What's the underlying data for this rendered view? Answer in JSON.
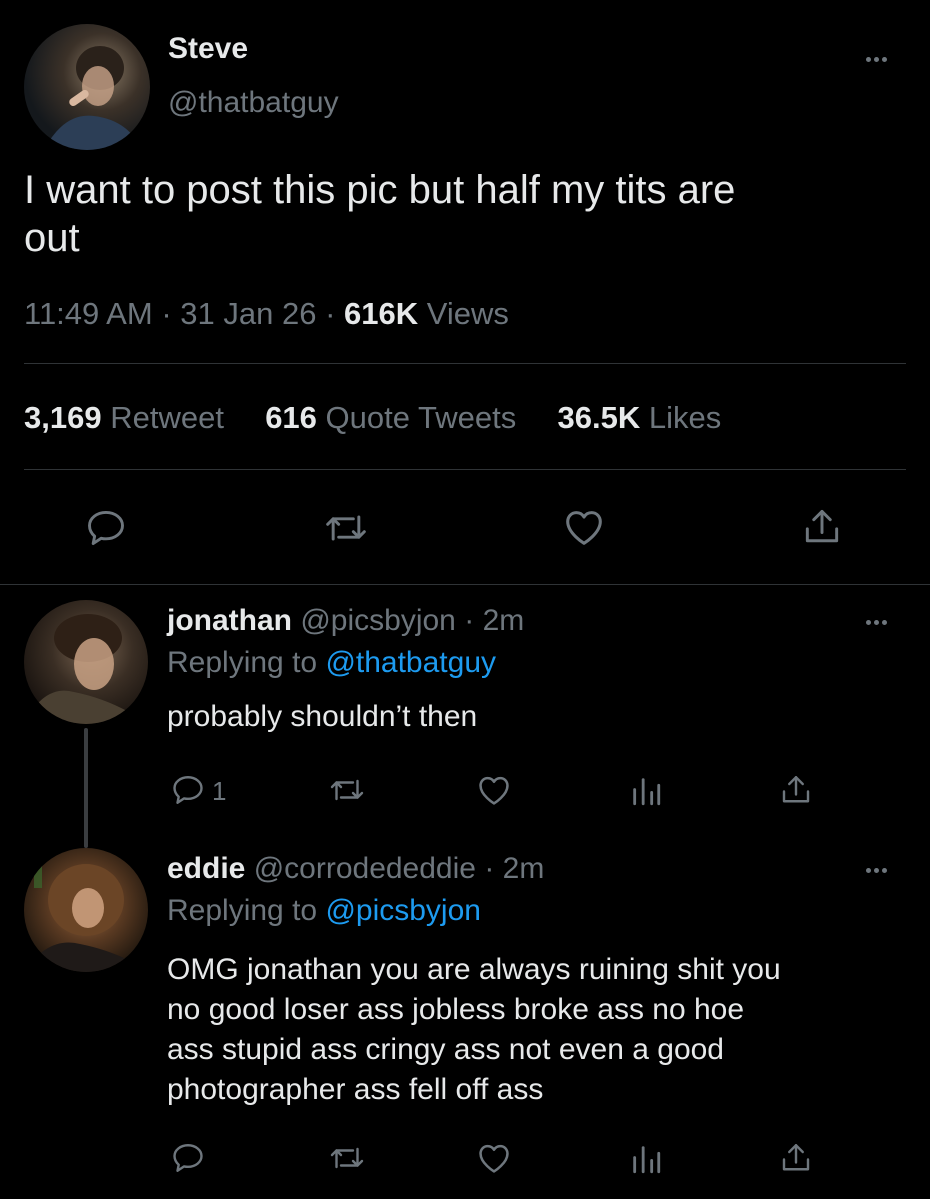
{
  "main_tweet": {
    "display_name": "Steve",
    "handle": "@thatbatguy",
    "text_line1": "I want to post this pic but half my tits are",
    "text_line2": "out",
    "time": "11:49 AM",
    "date": "31 Jan 26",
    "views_count": "616K",
    "views_label": "Views",
    "retweets_count": "3,169",
    "retweets_label": "Retweet",
    "quotes_count": "616",
    "quotes_label": "Quote Tweets",
    "likes_count": "36.5K",
    "likes_label": "Likes",
    "sep": "·"
  },
  "replies": [
    {
      "name": "jonathan",
      "handle": "@picsbyjon",
      "time": "2m",
      "replying_prefix": "Replying to",
      "replying_to": "@thatbatguy",
      "lines": [
        "probably shouldn’t then"
      ],
      "reply_count": "1",
      "sep": "·"
    },
    {
      "name": "eddie",
      "handle": "@corrodededdie",
      "time": "2m",
      "replying_prefix": "Replying to",
      "replying_to": "@picsbyjon",
      "lines": [
        "OMG jonathan you are always ruining shit you",
        "no good loser ass jobless broke ass no hoe",
        "ass stupid ass cringy ass not even a good",
        "photographer ass fell off ass"
      ],
      "sep": "·"
    }
  ],
  "colors": {
    "background": "#000000",
    "text": "#e7e9ea",
    "muted": "#6e767d",
    "link": "#1d9bf0",
    "divider": "#2f3336"
  },
  "icons": [
    "more-icon",
    "reply-icon",
    "retweet-icon",
    "like-icon",
    "share-icon",
    "analytics-icon"
  ]
}
